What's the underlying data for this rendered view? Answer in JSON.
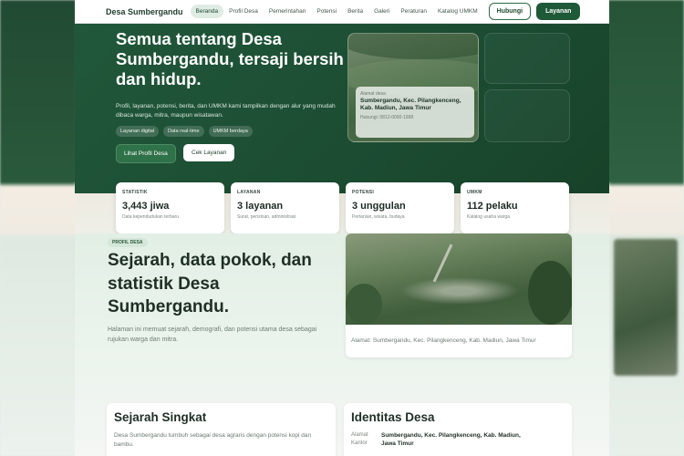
{
  "nav": {
    "brand": "Desa Sumbergandu",
    "items": [
      "Beranda",
      "Profil Desa",
      "Pemerintahan",
      "Potensi",
      "Berita",
      "Galeri",
      "Peraturan",
      "Katalog UMKM"
    ],
    "active_index": 0,
    "hubungi": "Hubungi",
    "layanan": "Layanan"
  },
  "hero": {
    "title": "Semua tentang Desa Sumbergandu, tersaji bersih dan hidup.",
    "description": "Profil, layanan, potensi, berita, dan UMKM kami tampilkan dengan alur yang mudah dibaca warga, mitra, maupun wisatawan.",
    "chips": [
      "Layanan digital",
      "Data real-time",
      "UMKM berdaya"
    ],
    "btn_profil": "Lihat Profil Desa",
    "btn_layanan": "Cek Layanan",
    "address_card": {
      "label": "Alamat desa",
      "value": "Sumbergandu, Kec. Pilangkenceng, Kab. Madiun, Jawa Timur",
      "phone": "Hubungi: 0812-0000-1998"
    }
  },
  "stats": [
    {
      "label": "STATISTIK",
      "value": "3,443 jiwa",
      "sub": "Data kependudukan terbaru"
    },
    {
      "label": "LAYANAN",
      "value": "3 layanan",
      "sub": "Surat, perizinan, administrasi"
    },
    {
      "label": "POTENSI",
      "value": "3 unggulan",
      "sub": "Pertanian, wisata, budaya"
    },
    {
      "label": "UMKM",
      "value": "112 pelaku",
      "sub": "Katalog usaha warga"
    }
  ],
  "profil": {
    "badge": "PROFIL DESA",
    "title": "Sejarah, data pokok, dan statistik Desa Sumbergandu.",
    "description": "Halaman ini memuat sejarah, demografi, dan potensi utama desa sebagai rujukan warga dan mitra.",
    "address": "Alamat: Sumbergandu, Kec. Pilangkenceng, Kab. Madiun, Jawa Timur"
  },
  "sejarah": {
    "title": "Sejarah Singkat",
    "text": "Desa Sumbergandu tumbuh sebagai desa agraris dengan potensi kopi dan bambu."
  },
  "identitas": {
    "title": "Identitas Desa",
    "key": "Alamat Kantor",
    "value": "Sumbergandu, Kec. Pilangkenceng, Kab. Madiun, Jawa Timur"
  },
  "backdrop": {
    "ghost_text": "Sejarah, data pokok, dan statistik Desa"
  },
  "colors": {
    "brand_green": "#1f5a38",
    "hero_bg": "#1c4d33",
    "accent_soft": "#dfece3"
  }
}
